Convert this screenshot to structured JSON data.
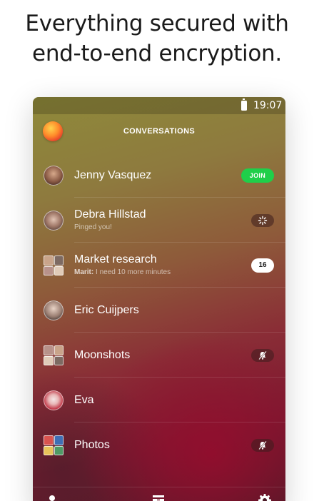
{
  "headline": {
    "line1": "Everything secured with",
    "line2": "end-to-end encryption."
  },
  "status_bar": {
    "time": "19:07",
    "battery_icon": "battery-full-icon"
  },
  "header": {
    "title": "CONVERSATIONS",
    "self_avatar": "user-avatar"
  },
  "conversations": [
    {
      "name": "Jenny Vasquez",
      "subtitle": "",
      "badge": "JOIN",
      "badge_type": "join"
    },
    {
      "name": "Debra Hillstad",
      "subtitle": "Pinged you!",
      "badge_type": "ping",
      "badge_icon": "ping-icon"
    },
    {
      "name": "Market research",
      "subtitle_sender": "Marit:",
      "subtitle": "I need 10 more minutes",
      "badge": "16",
      "badge_type": "count"
    },
    {
      "name": "Eric Cuijpers",
      "subtitle": ""
    },
    {
      "name": "Moonshots",
      "subtitle": "",
      "badge_type": "muted",
      "badge_icon": "muted-bell-icon"
    },
    {
      "name": "Eva",
      "subtitle": ""
    },
    {
      "name": "Photos",
      "subtitle": "",
      "badge_type": "muted",
      "badge_icon": "muted-bell-icon"
    }
  ],
  "tab_bar": {
    "items": [
      "contacts-icon",
      "archive-icon",
      "settings-icon"
    ]
  },
  "colors": {
    "join_green": "#1fcf4a",
    "text_white": "#ffffff",
    "headline_text": "#1a1a1a"
  }
}
